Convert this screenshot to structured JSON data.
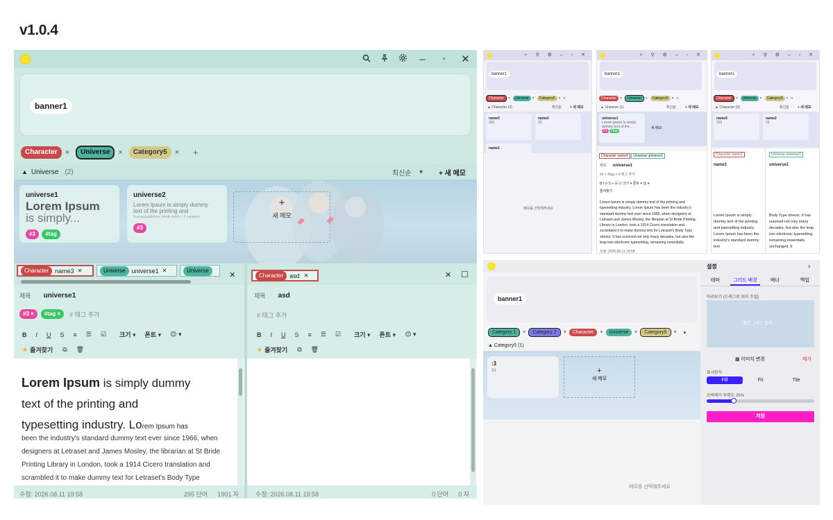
{
  "version": "v1.0.4",
  "main": {
    "banner_label": "banner1",
    "filter_tags": [
      {
        "label": "Character",
        "color": "#c9484a",
        "text_color": "#ffffff"
      },
      {
        "label": "Universe",
        "color": "#4db39e",
        "text_color": "#111111"
      },
      {
        "label": "Category5",
        "color": "#d3cb8a",
        "text_color": "#333333"
      }
    ],
    "tag_remove": "×",
    "add_tag": "+",
    "section_toggle": "▲",
    "section_title": "Universe",
    "section_count": "(2)",
    "sort_label": "최신순",
    "sort_arrow": "▾",
    "new_memo_button": "+ 새 메모",
    "cards": [
      {
        "title": "universe1",
        "lines": [
          "Lorem Ipsum",
          "is simply..."
        ],
        "tags": [
          "#3",
          "#tag"
        ]
      },
      {
        "title": "universe2",
        "lines": [
          "Lorem Ipsum is simply dummy",
          "text of the printing and",
          "typesetting industry. Lorem"
        ],
        "tags": [
          "#3"
        ]
      }
    ],
    "new_card_plus": "+",
    "new_card_label": "새 메모",
    "left_pane": {
      "tabs": [
        {
          "tag": "Character",
          "name": "name3"
        },
        {
          "tag": "Universe",
          "name": "universe1"
        },
        {
          "tag": "Universe",
          "name": ""
        }
      ],
      "close": "✕",
      "title_label": "제목",
      "title_value": "universe1",
      "memo_tags": [
        "#3 ×",
        "#tag ×"
      ],
      "add_tag_placeholder": "# 태그 추가",
      "toolbar": [
        "B",
        "I",
        "U",
        "S",
        "≡",
        "☰",
        "☑",
        "크기 ▾",
        "폰트 ▾",
        "😊 ▾"
      ],
      "favorite": "즐겨찾기",
      "copy_icon": "⧉",
      "delete_icon": "🗑",
      "content_large": "Lorem Ipsum",
      "content_line1": " is simply dummy",
      "content_line2": "text of the printing and",
      "content_line3": "typesetting industry. Lo",
      "content_small": "rem Ipsum has",
      "content_rest": [
        "been the industry's standard dummy text ever since 1966, when",
        "designers at Letraset and James Mosley, the librarian at St Bride",
        "Printing Library in London, took a 1914 Cicero translation and",
        "scrambled it to make dummy text for Letraset's Body Type"
      ],
      "status_date": "수정: 2026.08.11 19:58",
      "status_words": "295 단어",
      "status_chars": "1901 자"
    },
    "right_pane": {
      "tab_tag": "Character",
      "tab_name": "asd",
      "close": "✕",
      "maximize": "☐",
      "title_label": "제목",
      "title_value": "asd",
      "add_tag_placeholder": "# 태그 추가",
      "favorite": "즐겨찾기",
      "status_date": "수정: 2026.08.11 19:58",
      "status_words": "0 단어",
      "status_chars": "0 자"
    }
  },
  "thumb1": {
    "banner_label": "banner1",
    "tags": [
      "Character",
      "Universe",
      "Category5"
    ],
    "section": "▲ Character  (3)",
    "sort": "최신순",
    "new_memo": "+ 새 메모",
    "cards": [
      {
        "title": "name3",
        "sub": "333"
      },
      {
        "title": "name2",
        "sub": "22"
      },
      {
        "title": "name1",
        "sub": ""
      }
    ],
    "empty": "메모를 선택해주세요"
  },
  "thumb2": {
    "banner_label": "banner1",
    "tags": [
      "Character",
      "Universe",
      "Category5"
    ],
    "section": "▲ Universe  (1)",
    "sort": "최신순",
    "new_memo": "+ 새 메모",
    "card_title": "universe1",
    "card_text": "Lorem Ipsum is simply dummy text of the...",
    "card_tags": [
      "#3",
      "#tag"
    ],
    "new_card": "새 메모",
    "tabs": [
      "Character name3",
      "Universe universe1"
    ],
    "title_label": "제목",
    "title_value": "universe1",
    "tags_line": "#3 × #tag × # 태그 추가",
    "toolbar": "B I U S ≡ ☰ ☑ 크기 ▾ 폰트 ▾ 😊 ▾",
    "favorite": "즐겨찾기",
    "content": "Lorem Ipsum is simply dummy text of the printing and typesetting industry. Lorem Ipsum has been the industry's standard dummy text ever since 1966, when designers at Letraset and James Mosley, the librarian at St Bride Printing Library in London, took a 1914 Cicero translation and scrambled it to make dummy text for Letraset's Body Type sheets. It has survived not only many decades, but also the leap into electronic typesetting, remaining essentially",
    "status": "수정: 2026.08.11 19:58"
  },
  "thumb3": {
    "banner_label": "banner1",
    "tags": [
      "Character",
      "Universe",
      "Category5"
    ],
    "section": "▲ Character  (3)",
    "sort": "최신순",
    "new_memo": "+ 새 메모",
    "cards": [
      {
        "title": "name3",
        "sub": "333"
      },
      {
        "title": "name2",
        "sub": "22"
      }
    ],
    "left_tab": "Character name1",
    "right_tab": "Universe universe1",
    "left_title": "name1",
    "right_title": "universe1",
    "left_text": "Lorem Ipsum is simply dummy text of the printing and typesetting industry. Lorem Ipsum has been the industry's standard dummy text",
    "right_text": "Body Type sheets. It has survived not only many decades, but also the leap into electronic typesetting, remaining essentially unchanged. It"
  },
  "bottom": {
    "banner_label": "banner1",
    "tags": [
      {
        "label": "Category 1",
        "color": "#4db39e"
      },
      {
        "label": "Category 2",
        "color": "#7a7ae0"
      },
      {
        "label": "Character",
        "color": "#c9484a"
      },
      {
        "label": "Universe",
        "color": "#4db39e"
      },
      {
        "label": "Category5",
        "color": "#d3cb8a"
      }
    ],
    "section": "▲ Category5  (1)",
    "card_title": ":3",
    "card_sub": "33",
    "new_card_plus": "+",
    "new_card_label": "새 메모",
    "empty": "메모를 선택해주세요",
    "settings": {
      "title": "설정",
      "close": "›",
      "tabs": [
        "테마",
        "그리드 배경",
        "배너",
        "백업"
      ],
      "active_tab": 1,
      "preview_label": "미리보기 (드래그로 위치 조절)",
      "preview_text": "메모 그리드 영역",
      "change_image": "▩ 이미지 변경",
      "remove": "제거",
      "display_label": "표시방식",
      "display_options": [
        "Fill",
        "Fit",
        "Tile"
      ],
      "overlay_label": "오버레이 투명도 25%",
      "overlay_value": 0.25,
      "save": "저장",
      "accent": "#ff1fc6",
      "primary": "#3a1fff"
    }
  }
}
